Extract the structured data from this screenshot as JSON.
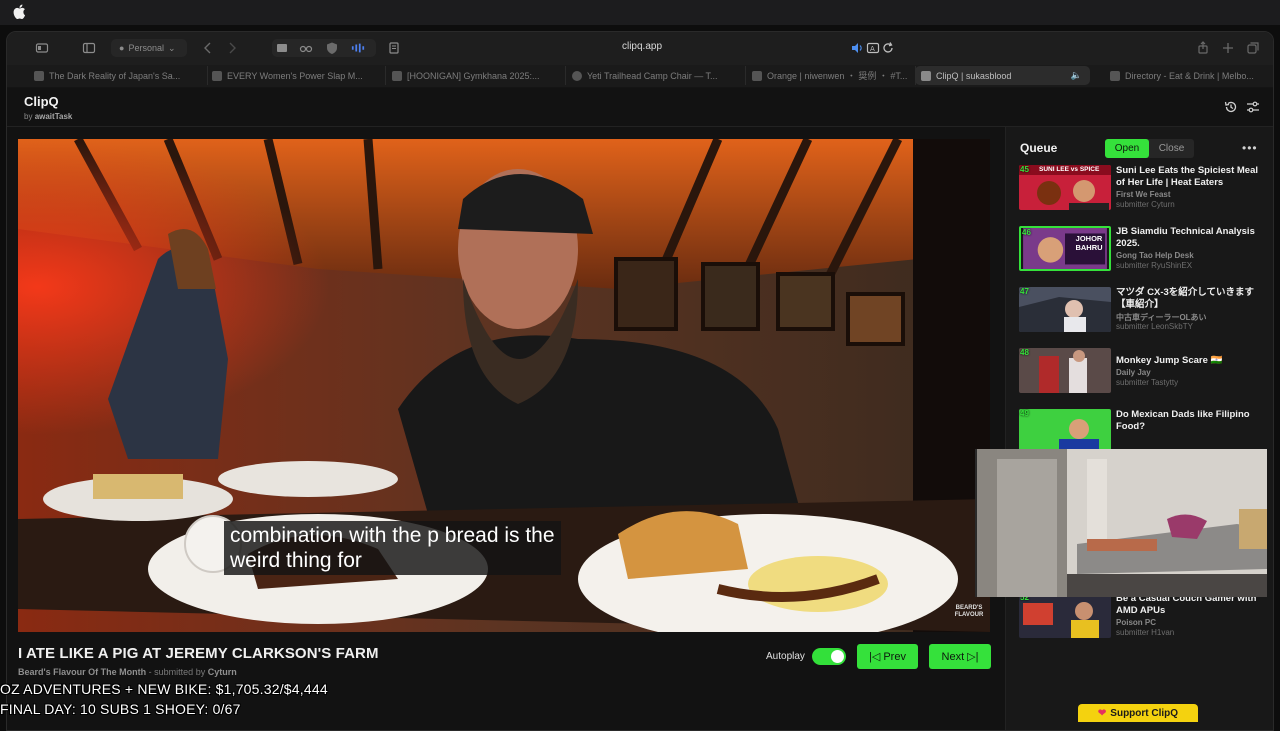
{
  "browser": {
    "profile_label": "Personal",
    "url": "clipq.app",
    "tabs": [
      {
        "label": "The Dark Reality of Japan's Sa..."
      },
      {
        "label": "EVERY Women's Power Slap M..."
      },
      {
        "label": "[HOONIGAN] Gymkhana 2025:..."
      },
      {
        "label": "Yeti Trailhead Camp Chair — T..."
      },
      {
        "label": "Orange | niwenwen ・ 奨例 ・ #T..."
      },
      {
        "label": "ClipQ | sukasblood"
      },
      {
        "label": "Directory - Eat & Drink | Melbo..."
      }
    ]
  },
  "app": {
    "name": "ClipQ",
    "by_prefix": "by",
    "by_author": "awaitTask"
  },
  "player": {
    "subtitle_lines": [
      "combination with the p bread is the",
      "weird thing for"
    ],
    "watermark": "BEARD'S FLAVOUR",
    "title": "I ATE LIKE A PIG AT JEREMY CLARKSON'S FARM",
    "channel": "Beard's Flavour Of The Month",
    "submitted_prefix": "- submitted by",
    "submitter": "Cyturn",
    "autoplay_label": "Autoplay",
    "autoplay_on": true,
    "prev_label": "Prev",
    "next_label": "Next"
  },
  "queue": {
    "title": "Queue",
    "open_label": "Open",
    "close_label": "Close",
    "items": [
      {
        "num": "45",
        "title": "Suni Lee Eats the Spiciest Meal of Her Life | Heat Eaters",
        "channel": "First We Feast",
        "submitter": "submitter Cyturn",
        "thumb_text": "SUNI LEE vs SPICE"
      },
      {
        "num": "46",
        "title": "JB Siamdiu Technical Analysis 2025.",
        "channel": "Gong Tao Help Desk",
        "submitter": "submitter RyuShinEX",
        "thumb_text": "JOHOR BAHRU"
      },
      {
        "num": "47",
        "title": "マツダ CX-3を紹介していきます【車紹介】",
        "channel": "中古車ディーラーOLあい",
        "submitter": "submitter LeonSkbTY",
        "thumb_text": ""
      },
      {
        "num": "48",
        "title": "Monkey Jump Scare 🇮🇳",
        "channel": "Daily Jay",
        "submitter": "submitter Tastytty",
        "thumb_text": ""
      },
      {
        "num": "49",
        "title": "Do Mexican Dads like Filipino Food?",
        "channel": "",
        "submitter": "",
        "thumb_text": ""
      },
      {
        "num": "52",
        "title": "Be a Casual Couch Gamer with AMD APUs",
        "channel": "Poison PC",
        "submitter": "submitter H1van",
        "thumb_text": ""
      }
    ],
    "support_label": "Support ClipQ"
  },
  "stream_overlay": {
    "line1": "OZ ADVENTURES + NEW BIKE: $1,705.32/$4,444",
    "line2": "FINAL DAY: 10 SUBS 1 SHOEY: 0/67"
  },
  "colors": {
    "accent": "#35e13b",
    "support": "#f4d20f",
    "background": "#121212"
  }
}
